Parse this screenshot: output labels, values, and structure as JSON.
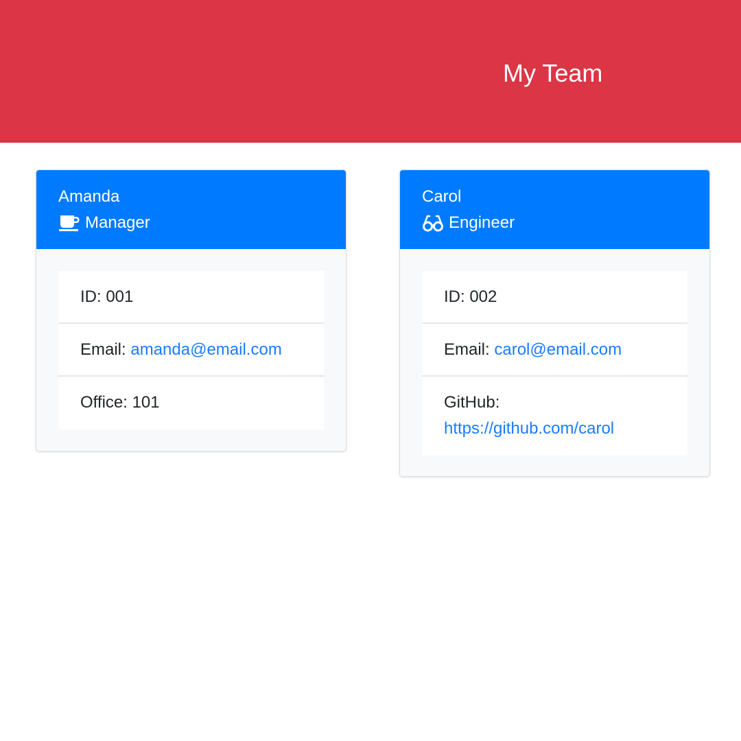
{
  "header": {
    "title": "My Team"
  },
  "colors": {
    "header_bg": "#dc3545",
    "card_header_bg": "#007bff",
    "link": "#1a7cff"
  },
  "employees": [
    {
      "name": "Amanda",
      "role": "Manager",
      "role_icon": "coffee-mug-icon",
      "id_label": "ID: 001",
      "email_label": "Email: ",
      "email": "amanda@email.com",
      "extra_label": "Office: 101"
    },
    {
      "name": "Carol",
      "role": "Engineer",
      "role_icon": "glasses-icon",
      "id_label": "ID: 002",
      "email_label": "Email: ",
      "email": "carol@email.com",
      "extra_label": "GitHub:",
      "github": "https://github.com/carol"
    }
  ]
}
